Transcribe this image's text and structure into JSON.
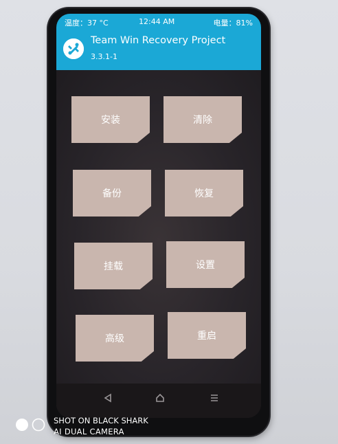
{
  "statusbar": {
    "temperature": "温度：37 °C",
    "time": "12:44 AM",
    "battery": "电量：81%"
  },
  "header": {
    "title": "Team Win Recovery Project",
    "version": "3.3.1-1",
    "logo_icon": "twrp-logo-icon"
  },
  "buttons": [
    {
      "label": "安装"
    },
    {
      "label": "清除"
    },
    {
      "label": "备份"
    },
    {
      "label": "恢复"
    },
    {
      "label": "挂载"
    },
    {
      "label": "设置"
    },
    {
      "label": "高级"
    },
    {
      "label": "重启"
    }
  ],
  "navbar": {
    "back_icon": "back-triangle-icon",
    "home_icon": "home-icon",
    "menu_icon": "menu-lines-icon"
  },
  "watermark": {
    "line1": "SHOT ON BLACK SHARK",
    "line2": "AI DUAL CAMERA"
  },
  "colors": {
    "header_blue": "#1ba8d6",
    "button_fill": "#c9b6ae",
    "screen_bg": "#2a2528"
  }
}
